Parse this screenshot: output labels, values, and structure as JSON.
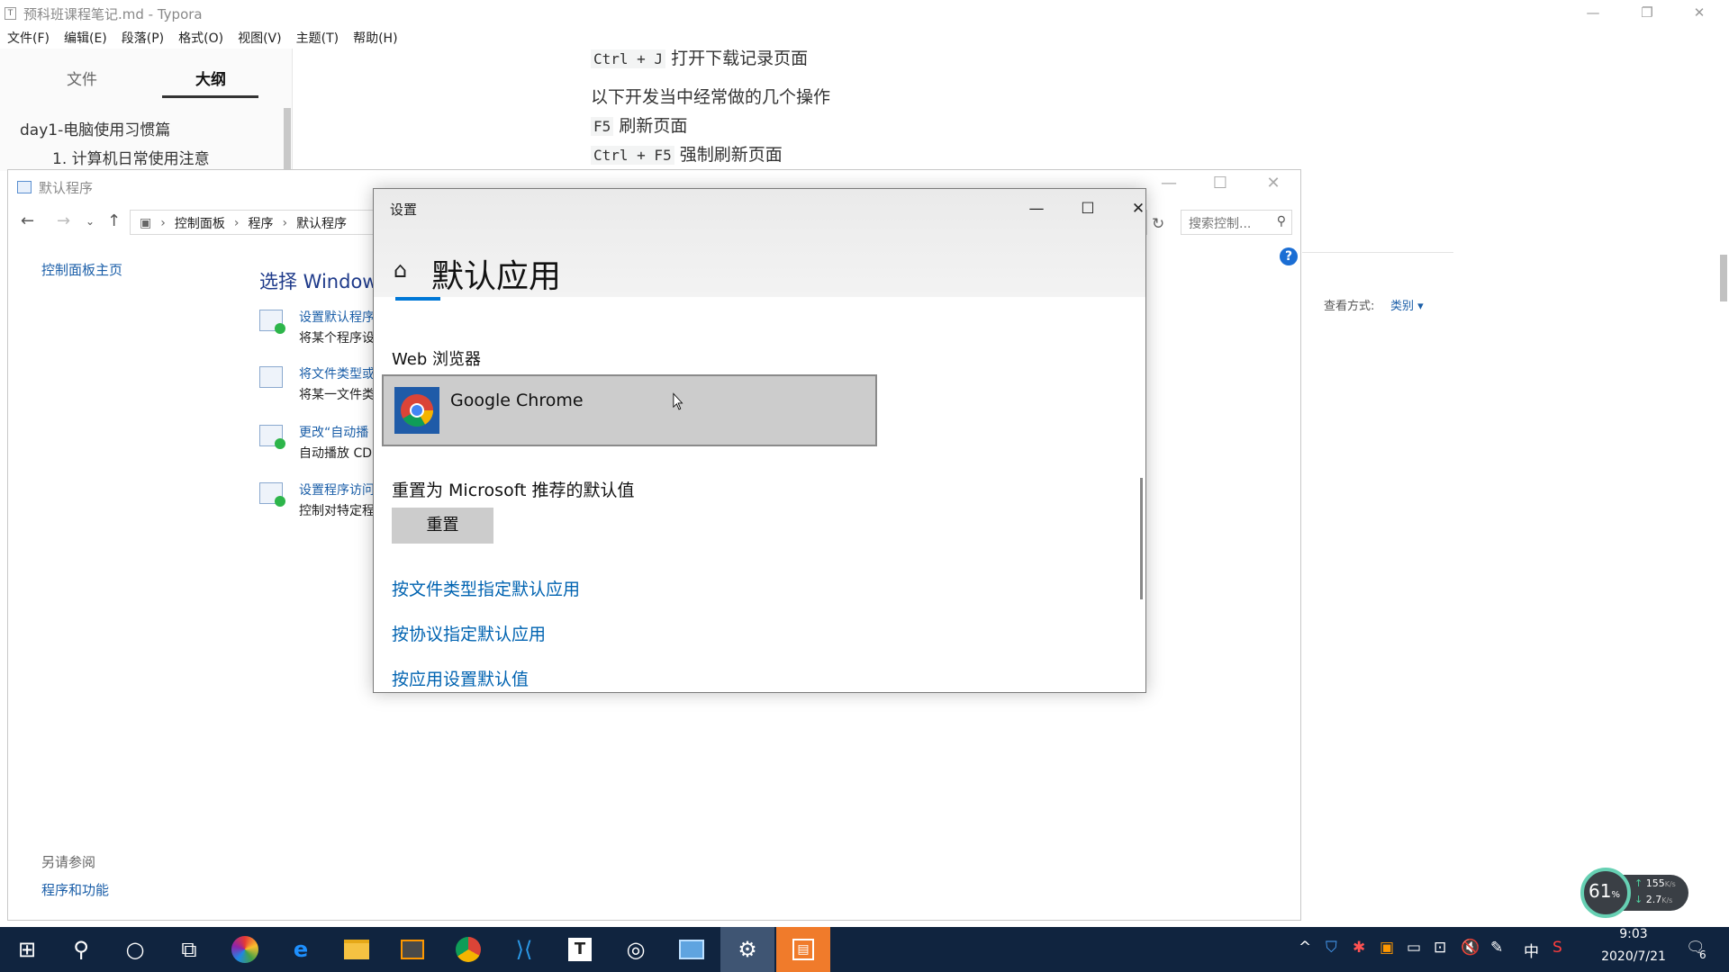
{
  "typora": {
    "window_title": "预科班课程笔记.md - Typora",
    "app_icon_letter": "T",
    "menu": [
      "文件(F)",
      "编辑(E)",
      "段落(P)",
      "格式(O)",
      "视图(V)",
      "主题(T)",
      "帮助(H)"
    ],
    "sidebar": {
      "tab_files": "文件",
      "tab_outline": "大纲",
      "outline_items": [
        "day1-电脑使用习惯篇",
        "1. 计算机日常使用注意"
      ]
    },
    "content": {
      "line1_key": "Ctrl + J",
      "line1_text": "打开下载记录页面",
      "line2_text": "以下开发当中经常做的几个操作",
      "line3_key": "F5",
      "line3_text": "刷新页面",
      "line4_key": "Ctrl + F5",
      "line4_text": "强制刷新页面"
    }
  },
  "control_panel": {
    "window_title": "默认程序",
    "breadcrumb": [
      "控制面板",
      "程序",
      "默认程序"
    ],
    "search_placeholder": "搜索控制...",
    "left_link": "控制面板主页",
    "heading": "选择 Window",
    "tasks": [
      {
        "link": "设置默认程序",
        "desc": "将某个程序设"
      },
      {
        "link": "将文件类型或",
        "desc": "将某一文件类"
      },
      {
        "link": "更改“自动播",
        "desc": "自动播放 CD"
      },
      {
        "link": "设置程序访问",
        "desc": "控制对特定程"
      }
    ],
    "view_label": "查看方式:",
    "view_value": "类别 ▾",
    "see_also": "另请参阅",
    "programs_link": "程序和功能"
  },
  "settings": {
    "window_title": "设置",
    "page_title": "默认应用",
    "web_browser_label": "Web 浏览器",
    "browser_name": "Google Chrome",
    "reset_label": "重置为 Microsoft 推荐的默认值",
    "reset_button": "重置",
    "links": [
      "按文件类型指定默认应用",
      "按协议指定默认应用",
      "按应用设置默认值"
    ]
  },
  "taskbar": {
    "time": "9:03",
    "date": "2020/7/21",
    "ime": "中",
    "notification_count": "6",
    "apps": [
      "start-icon",
      "search-icon",
      "cortana-icon",
      "task-view-icon",
      "color-app-icon",
      "edge-icon",
      "file-explorer-icon",
      "sublime-icon",
      "chrome-icon",
      "vscode-icon",
      "typora-icon",
      "app-icon",
      "control-panel-icon",
      "settings-icon",
      "orange-app-icon"
    ]
  },
  "net_widget": {
    "percent": "61",
    "percent_unit": "%",
    "up": "155",
    "up_unit": "K/s",
    "down": "2.7",
    "down_unit": "K/s"
  }
}
